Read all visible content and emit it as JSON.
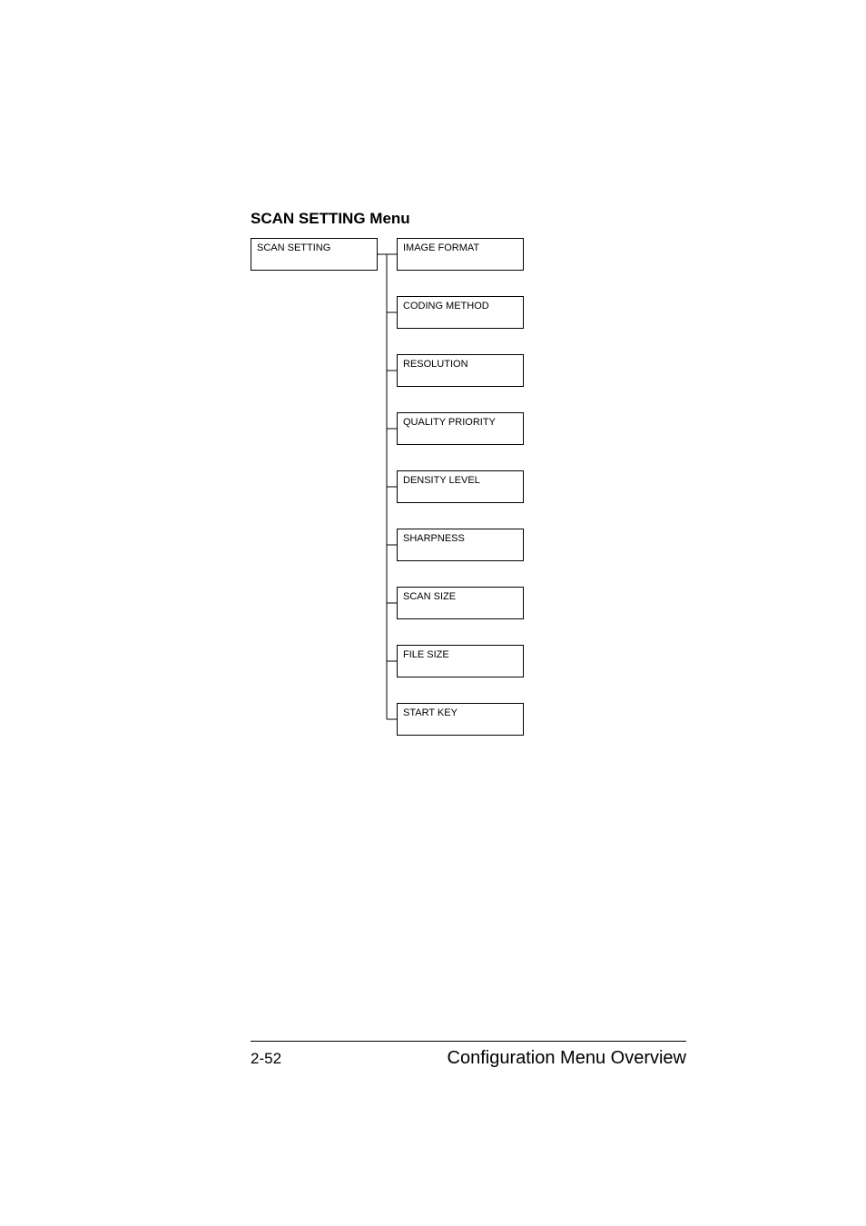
{
  "heading": "SCAN SETTING Menu",
  "root": {
    "label": "SCAN SETTING"
  },
  "children": [
    {
      "label": "IMAGE FORMAT"
    },
    {
      "label": "CODING METHOD"
    },
    {
      "label": "RESOLUTION"
    },
    {
      "label": "QUALITY PRIORITY"
    },
    {
      "label": "DENSITY LEVEL"
    },
    {
      "label": "SHARPNESS"
    },
    {
      "label": "SCAN SIZE"
    },
    {
      "label": "FILE SIZE"
    },
    {
      "label": "START KEY"
    }
  ],
  "footer": {
    "page": "2-52",
    "title": "Configuration Menu Overview"
  },
  "chart_data": {
    "type": "table",
    "title": "SCAN SETTING Menu hierarchy",
    "root": "SCAN SETTING",
    "items": [
      "IMAGE FORMAT",
      "CODING METHOD",
      "RESOLUTION",
      "QUALITY PRIORITY",
      "DENSITY LEVEL",
      "SHARPNESS",
      "SCAN SIZE",
      "FILE SIZE",
      "START KEY"
    ]
  }
}
